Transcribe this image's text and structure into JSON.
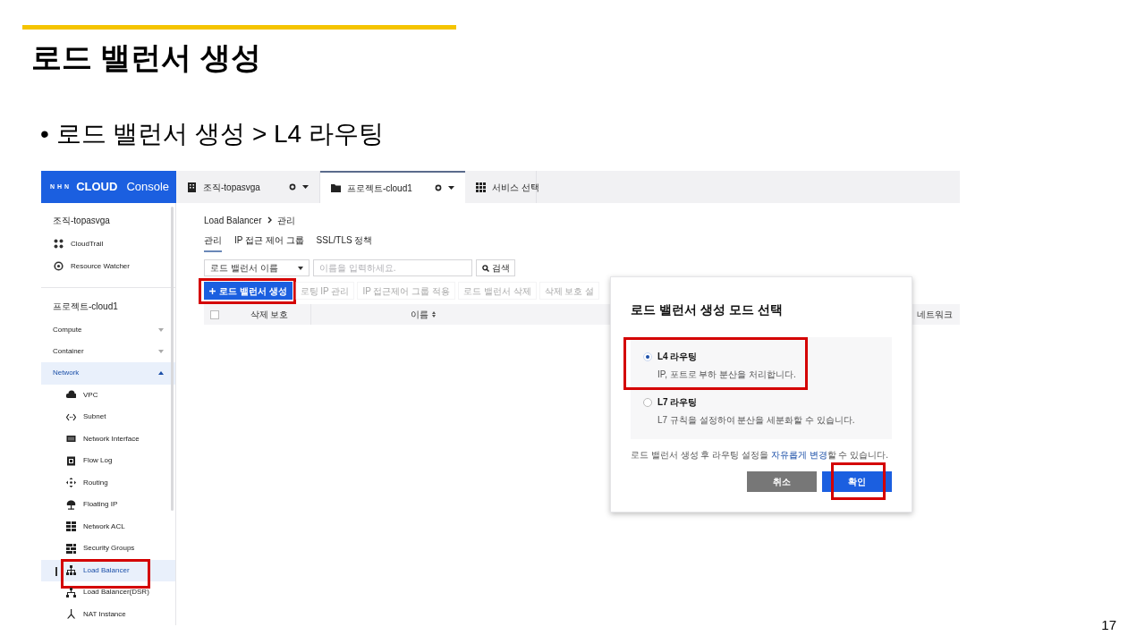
{
  "slide": {
    "title": "로드 밸런서 생성",
    "bullet": "• 로드 밸런서 생성 > L4 라우팅",
    "page_number": "17"
  },
  "console": {
    "logo": {
      "prefix": "NHN",
      "brand": "CLOUD",
      "product": "Console"
    },
    "header_tabs": [
      {
        "label": "조직-topasvga",
        "kind": "org",
        "selected": false
      },
      {
        "label": "프로젝트-cloud1",
        "kind": "project",
        "selected": true
      },
      {
        "label": "서비스 선택",
        "kind": "services",
        "selected": false
      }
    ],
    "sidebar": {
      "org_label": "조직-topasvga",
      "org_items": [
        "CloudTrail",
        "Resource Watcher"
      ],
      "project_label": "프로젝트-cloud1",
      "menu": [
        {
          "label": "Compute",
          "expanded": false
        },
        {
          "label": "Container",
          "expanded": false
        },
        {
          "label": "Network",
          "expanded": true,
          "children": [
            {
              "label": "VPC",
              "selected": false,
              "highlighted": false
            },
            {
              "label": "Subnet",
              "selected": false,
              "highlighted": false
            },
            {
              "label": "Network Interface",
              "selected": false,
              "highlighted": false
            },
            {
              "label": "Flow Log",
              "selected": false,
              "highlighted": false
            },
            {
              "label": "Routing",
              "selected": false,
              "highlighted": false
            },
            {
              "label": "Floating IP",
              "selected": false,
              "highlighted": false
            },
            {
              "label": "Network ACL",
              "selected": false,
              "highlighted": false
            },
            {
              "label": "Security Groups",
              "selected": false,
              "highlighted": false
            },
            {
              "label": "Load Balancer",
              "selected": true,
              "highlighted": true
            },
            {
              "label": "Load Balancer(DSR)",
              "selected": false,
              "highlighted": false
            },
            {
              "label": "NAT Instance",
              "selected": false,
              "highlighted": false
            }
          ]
        }
      ]
    },
    "breadcrumb": [
      "Load Balancer",
      "관리"
    ],
    "tabs": [
      {
        "label": "관리",
        "selected": true
      },
      {
        "label": "IP 접근 제어 그룹",
        "selected": false
      },
      {
        "label": "SSL/TLS 정책",
        "selected": false
      }
    ],
    "filter": {
      "select": "로드 밸런서 이름",
      "placeholder": "이름을 입력하세요.",
      "search_button": "검색"
    },
    "toolbar": [
      {
        "label": "로드 밸런서 생성",
        "kind": "create",
        "disabled": false,
        "highlighted": true
      },
      {
        "label": "로팅 IP 관리",
        "kind": "plain",
        "disabled": true,
        "highlighted": false
      },
      {
        "label": "IP 접근제어 그룹 적용",
        "kind": "plain",
        "disabled": true,
        "highlighted": false
      },
      {
        "label": "로드 밸런서 삭제",
        "kind": "plain",
        "disabled": true,
        "highlighted": false
      },
      {
        "label": "삭제 보호 설",
        "kind": "plain",
        "disabled": true,
        "highlighted": false
      }
    ],
    "table": {
      "header_checkbox": {
        "checked": false
      },
      "columns": [
        "삭제 보호",
        "이름",
        "네트워크"
      ]
    },
    "modal": {
      "title": "로드 밸런서 생성 모드 선택",
      "options": [
        {
          "title": "L4 라우팅",
          "description": "IP, 포트로 부하 분산을 처리합니다.",
          "selected": true,
          "highlighted": true
        },
        {
          "title": "L7 라우팅",
          "description": "L7 규칙을 설정하여 분산을 세분화할 수 있습니다.",
          "selected": false,
          "highlighted": false
        }
      ],
      "note_before": "로드 밸런서 생성 후 라우팅 설정을",
      "note_link": "자유롭게 변경",
      "note_after": "할 수 있습니다.",
      "buttons": [
        {
          "label": "취소",
          "kind": "secondary",
          "highlighted": false
        },
        {
          "label": "확인",
          "kind": "primary",
          "highlighted": true
        }
      ]
    }
  }
}
